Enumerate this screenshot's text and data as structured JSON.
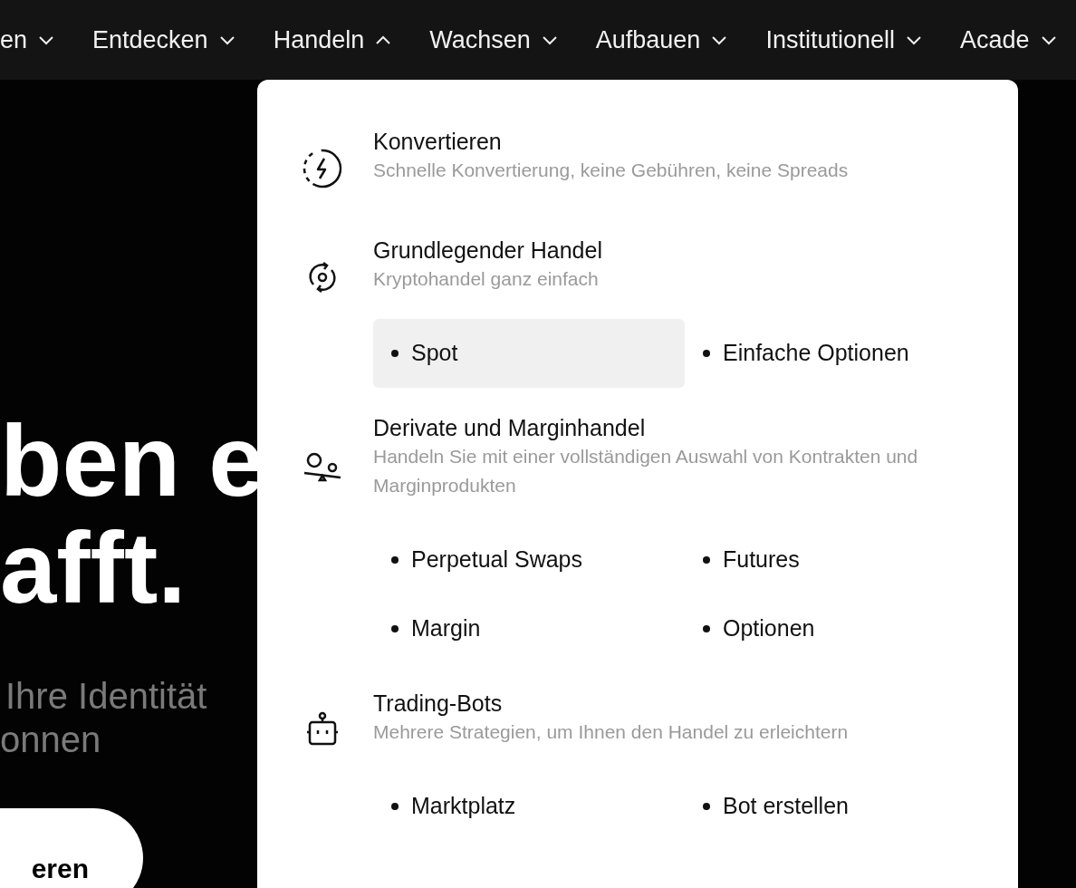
{
  "nav": {
    "items": [
      {
        "label": "en",
        "expanded": false
      },
      {
        "label": "Entdecken",
        "expanded": false
      },
      {
        "label": "Handeln",
        "expanded": true
      },
      {
        "label": "Wachsen",
        "expanded": false
      },
      {
        "label": "Aufbauen",
        "expanded": false
      },
      {
        "label": "Institutionell",
        "expanded": false
      },
      {
        "label": "Acade",
        "expanded": false
      }
    ]
  },
  "hero": {
    "headline": [
      "ben e",
      "afft."
    ],
    "subtitle": [
      "Ihre Identität",
      "onnen"
    ],
    "button": "eren"
  },
  "dropdown": {
    "sections": [
      {
        "kind": "bolt",
        "title": "Konvertieren",
        "description": "Schnelle Konvertierung, keine Gebühren, keine Spreads"
      },
      {
        "kind": "cycle",
        "title": "Grundlegender Handel",
        "description": "Kryptohandel ganz einfach",
        "links": [
          {
            "label": "Spot",
            "selected": true
          },
          {
            "label": "Einfache Optionen",
            "selected": false
          }
        ]
      },
      {
        "kind": "balance",
        "title": "Derivate und Marginhandel",
        "description": "Handeln Sie mit einer vollständigen Auswahl von Kontrakten und Marginprodukten",
        "links": [
          {
            "label": "Perpetual Swaps",
            "selected": false
          },
          {
            "label": "Futures",
            "selected": false
          },
          {
            "label": "Margin",
            "selected": false
          },
          {
            "label": "Optionen",
            "selected": false
          }
        ]
      },
      {
        "kind": "robot",
        "title": "Trading-Bots",
        "description": "Mehrere Strategien, um Ihnen den Handel zu erleichtern",
        "links": [
          {
            "label": "Marktplatz",
            "selected": false
          },
          {
            "label": "Bot erstellen",
            "selected": false
          }
        ]
      }
    ]
  }
}
